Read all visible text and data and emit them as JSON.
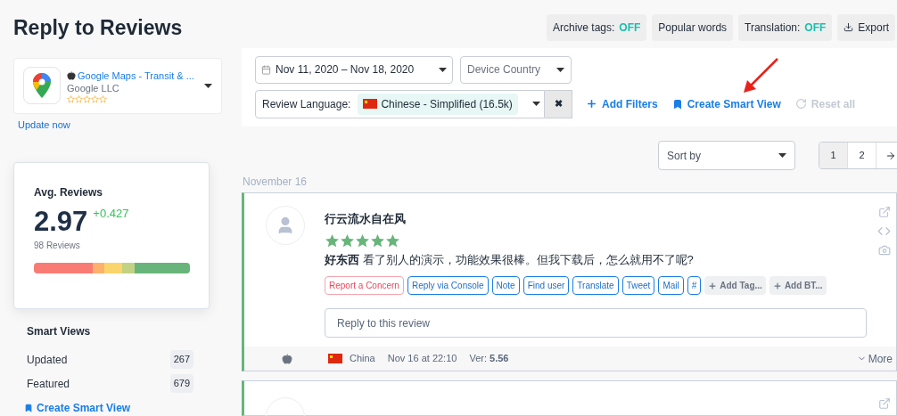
{
  "page_title": "Reply to Reviews",
  "toolbar": [
    {
      "kind": "toggle",
      "label": "Archive tags: ",
      "value": "OFF"
    },
    {
      "kind": "plain",
      "label": "Popular words"
    },
    {
      "kind": "toggle",
      "label": "Translation: ",
      "value": "OFF"
    },
    {
      "kind": "export",
      "label": "Export"
    }
  ],
  "app": {
    "name": "Google Maps - Transit & ...",
    "developer": "Google LLC",
    "stars": 0,
    "update_link": "Update now"
  },
  "avg_card": {
    "title": "Avg. Reviews",
    "value": "2.97",
    "change": "+0.427",
    "count": "98 Reviews"
  },
  "smart_views": {
    "title": "Smart Views",
    "items": [
      {
        "label": "Updated",
        "count": "267"
      },
      {
        "label": "Featured",
        "count": "679"
      }
    ],
    "create_link": "Create Smart View"
  },
  "filters": {
    "date_range": "Nov 11, 2020 – Nov 18, 2020",
    "device_country": {
      "placeholder": "Device Country"
    },
    "language_label": "Review Language:",
    "language_value": "Chinese - Simplified (16.5k)",
    "clear_button": "✖",
    "links": [
      {
        "kind": "add",
        "label": "Add Filters",
        "disabled": false
      },
      {
        "kind": "bookmark",
        "label": "Create Smart View",
        "disabled": false
      },
      {
        "kind": "reset",
        "label": "Reset all",
        "disabled": true
      }
    ]
  },
  "sort": {
    "placeholder": "Sort by"
  },
  "pagination": [
    {
      "label": "1",
      "selected": true
    },
    {
      "label": "2",
      "selected": false
    }
  ],
  "date_heading": "November 16",
  "review": {
    "author": "行云流水自在风",
    "stars": 5,
    "text": "**好东西** 看了别人的演示，功能效果很棒。但我下载后，怎么就用不了呢?",
    "actions": [
      {
        "kind": "danger",
        "label": "Report a Concern"
      },
      {
        "kind": "outline",
        "label": "Reply via Console"
      },
      {
        "kind": "outline",
        "label": "Note"
      },
      {
        "kind": "outline",
        "label": "Find user"
      },
      {
        "kind": "outline",
        "label": "Translate"
      },
      {
        "kind": "outline",
        "label": "Tweet"
      },
      {
        "kind": "outline",
        "label": "Mail"
      },
      {
        "kind": "outline",
        "label": "#"
      },
      {
        "kind": "tag",
        "label": "Add Tag..."
      },
      {
        "kind": "tag",
        "label": "Add BT..."
      }
    ],
    "reply": {
      "placeholder": "Reply to this review"
    },
    "country": "China",
    "date": "Nov 16 at 22:10",
    "version_label": "Ver: ",
    "version": "5.56",
    "more": "More"
  }
}
